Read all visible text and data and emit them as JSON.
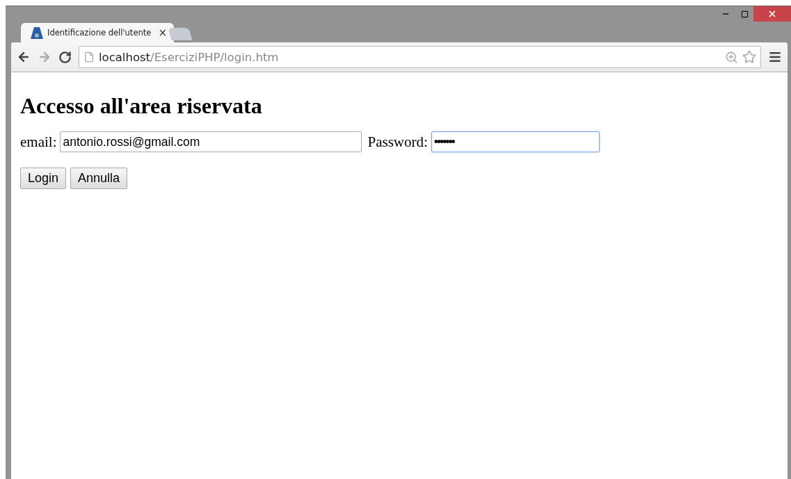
{
  "tabs": [
    {
      "title": "Identificazione dell'utente",
      "close": "×",
      "selected": true
    },
    {
      "selected": false
    }
  ],
  "address_bar": {
    "host": "localhost",
    "path": "/EserciziPHP/login.htm"
  },
  "heading": "Accesso all'area riservata",
  "fields": [
    {
      "label": "email:",
      "value": "antonio.rossi@gmail.com",
      "focused": false,
      "kind": "text"
    },
    {
      "label": "Password:",
      "value": "•••••••",
      "focused": true,
      "kind": "password"
    }
  ],
  "buttons": [
    "Login",
    "Annulla"
  ]
}
